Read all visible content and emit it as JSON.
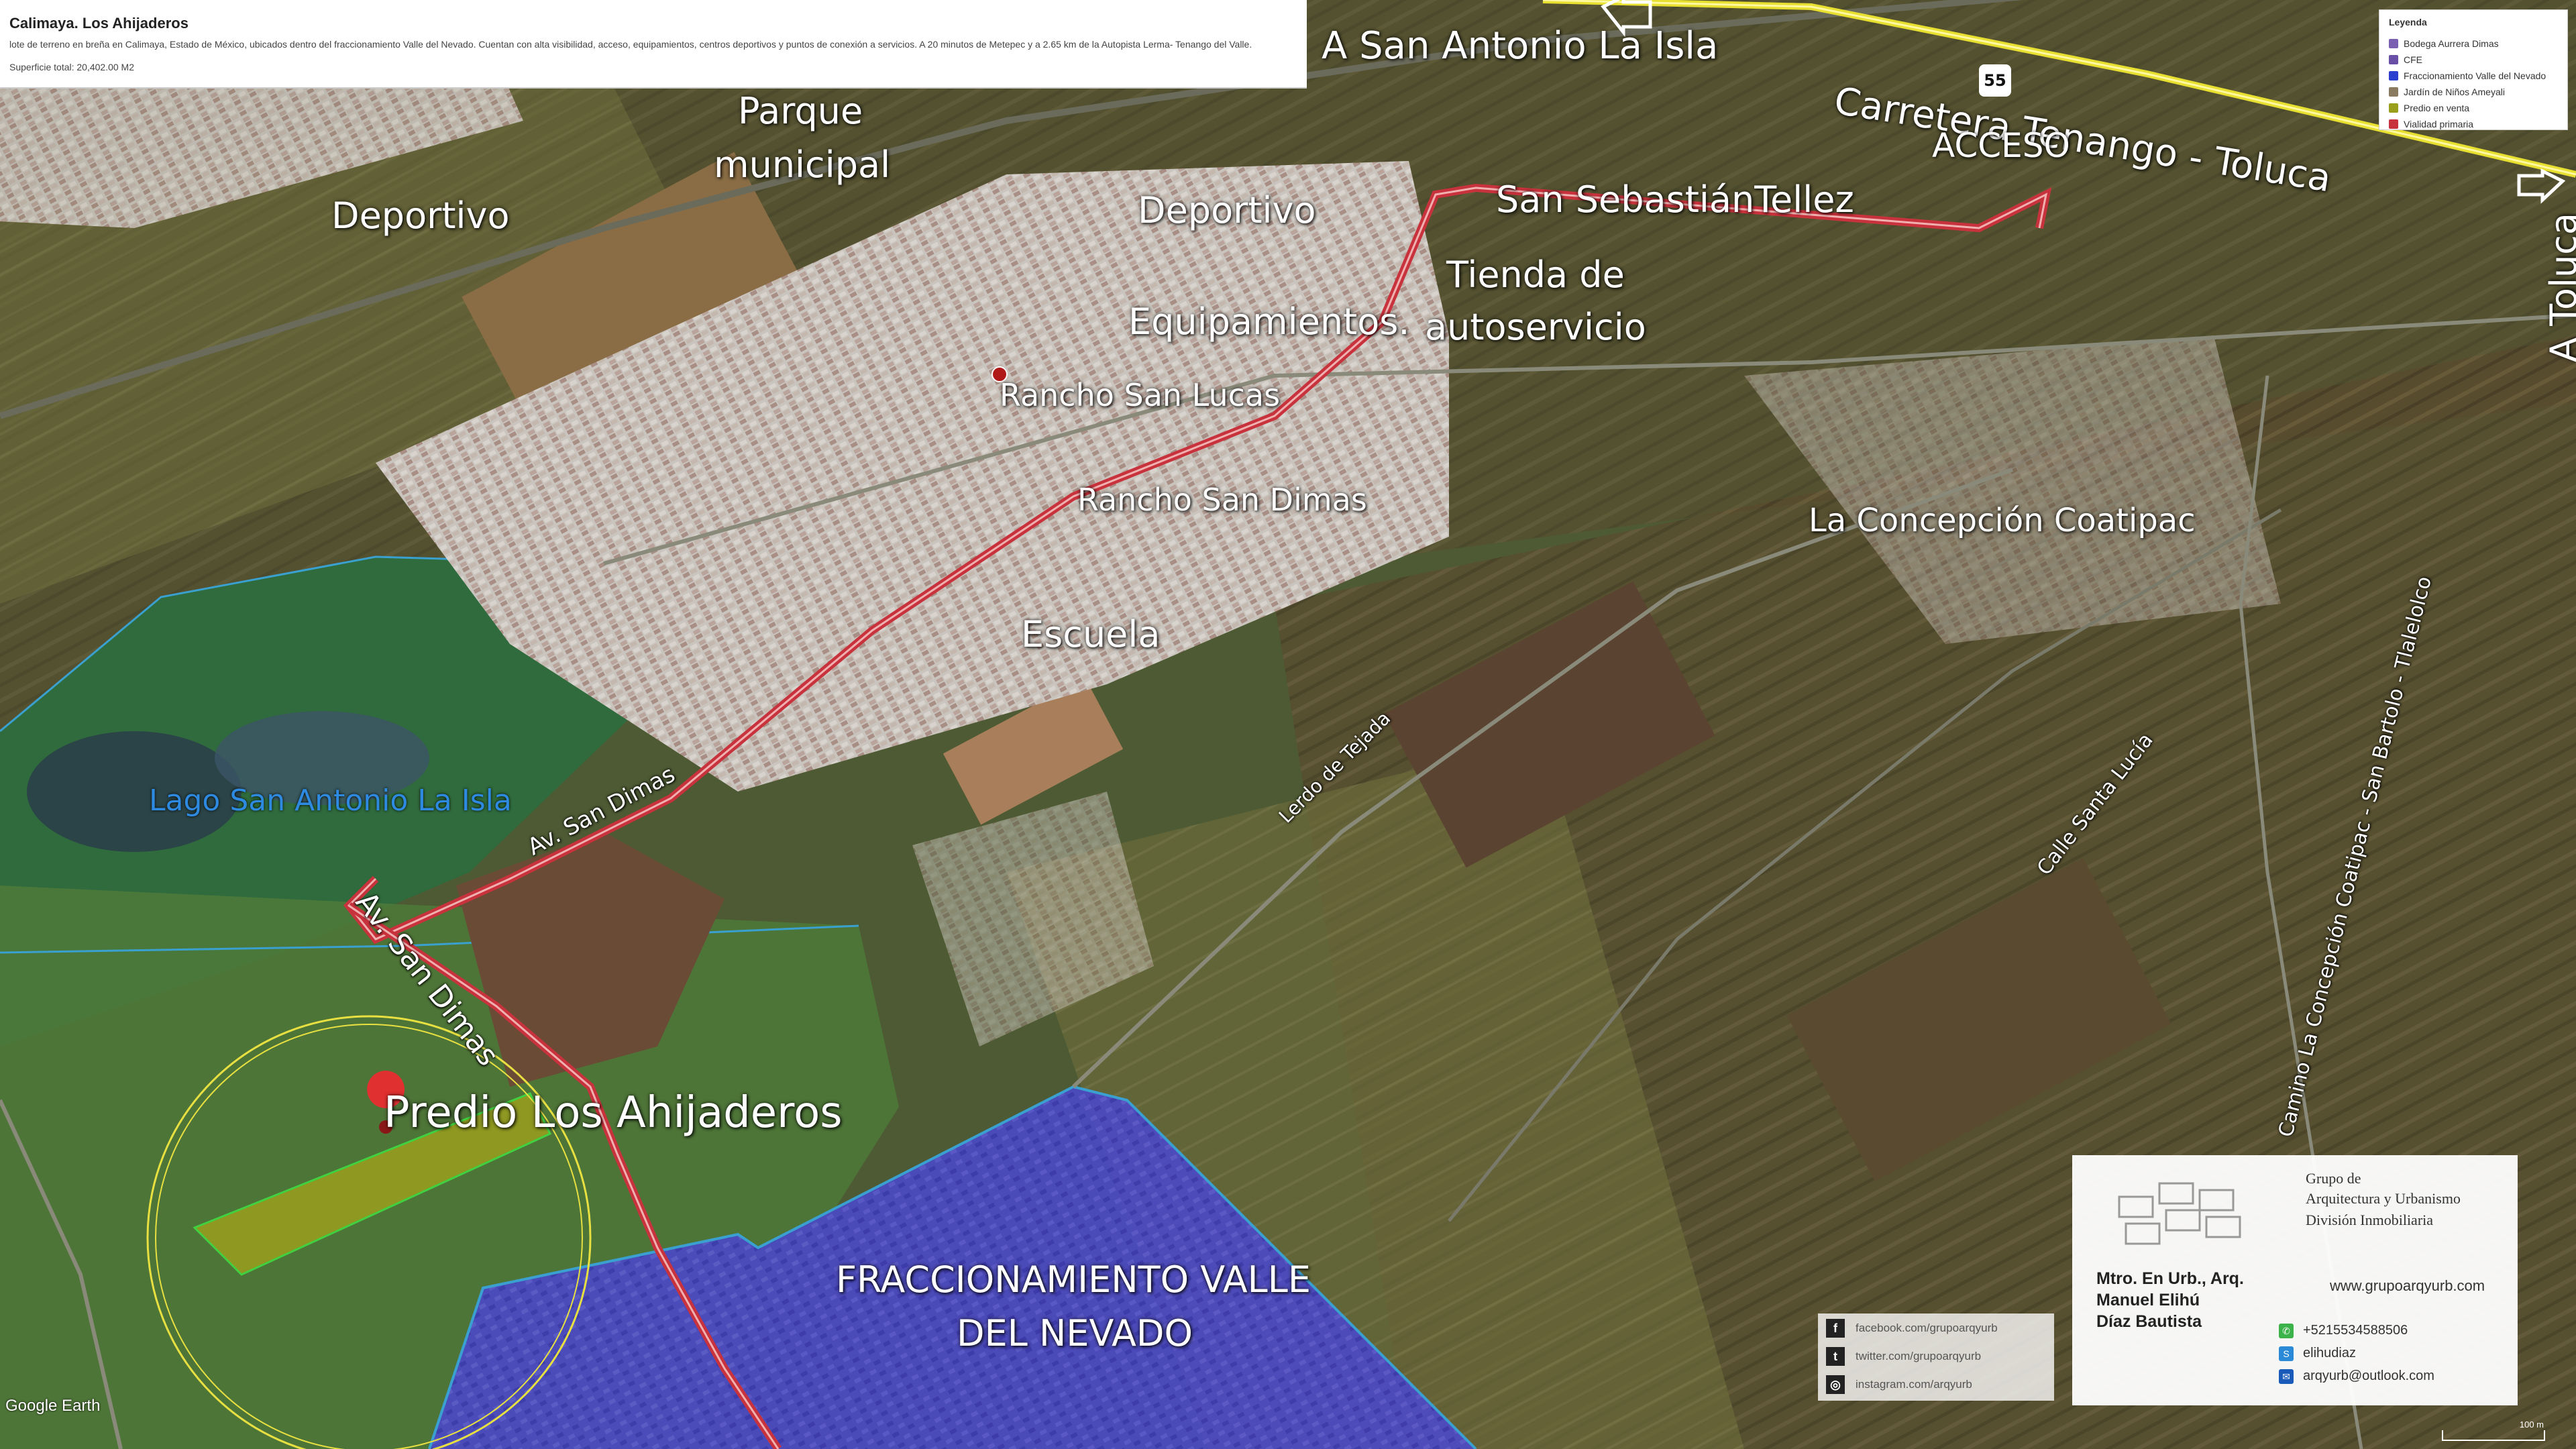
{
  "info": {
    "title": "Calimaya. Los Ahijaderos",
    "description": "lote de terreno en breña en Calimaya, Estado de México, ubicados dentro del fraccionamiento Valle del Nevado. Cuentan con alta visibilidad, acceso, equipamientos, centros deportivos y puntos de conexión a servicios. A 20 minutos de Metepec y a 2.65 km de la Autopista Lerma- Tenango del Valle.",
    "surface": "Superficie total: 20,402.00 M2"
  },
  "legend": {
    "heading": "Leyenda",
    "items": [
      {
        "label": "Bodega Aurrera Dimas",
        "color": "#7b5fb0"
      },
      {
        "label": "CFE",
        "color": "#6a4fa8"
      },
      {
        "label": "Fraccionamiento Valle del Nevado",
        "color": "#2a3fd0"
      },
      {
        "label": "Jardín de Niños Ameyali",
        "color": "#8a7a60"
      },
      {
        "label": "Predio en venta",
        "color": "#9aa01c"
      },
      {
        "label": "Vialidad primaria",
        "color": "#c8323c"
      }
    ]
  },
  "labels": {
    "a_san_antonio": "A San Antonio La Isla",
    "carretera": "Carretera Tenango - Toluca",
    "acceso": "ACCESO",
    "a_toluca": "A Toluca",
    "parque": "Parque",
    "municipal": "municipal",
    "deportivo_1": "Deportivo",
    "deportivo_2": "Deportivo",
    "san_sebastian": "San SebastiánTellez",
    "tienda": "Tienda de",
    "autoservicio": "autoservicio",
    "equipamientos": "Equipamientos.",
    "rancho_san_lucas": "Rancho San Lucas",
    "rancho_san_dimas": "Rancho San Dimas",
    "la_concepcion": "La Concepción Coatipac",
    "escuela": "Escuela",
    "lago": "Lago San Antonio La Isla",
    "predio": "Predio Los Ahijaderos",
    "fracc_1": "FRACCIONAMIENTO VALLE",
    "fracc_2": "DEL NEVADO",
    "av_san_dimas_1": "Av. San Dimas",
    "av_san_dimas_2": "Av. San Dimas",
    "lerdo": "Lerdo de Tejada",
    "calle_santa_lucia": "Calle Santa Lucía",
    "camino": "Camino La Concepción Coatipac - San Bartolo - Tlalelolco",
    "highway_shield": "55"
  },
  "card": {
    "org_line1": "Grupo de",
    "org_line2": "Arquitectura y Urbanismo",
    "org_line3": "División Inmobiliaria",
    "name_line1": "Mtro. En Urb., Arq.",
    "name_line2": "Manuel Elihú",
    "name_line3": "Díaz Bautista",
    "website": "www.grupoarqyurb.com",
    "phone": "+5215534588506",
    "skype": "elihudiaz",
    "email": "arqyurb@outlook.com"
  },
  "social": {
    "facebook": "facebook.com/grupoarqyurb",
    "twitter": "twitter.com/grupoarqyurb",
    "instagram": "instagram.com/arqyurb"
  },
  "footer": {
    "brand": "Google Earth",
    "scale": "100 m"
  },
  "colors": {
    "fracc_fill": "#3f3fd0",
    "predio_fill": "#9a9a10",
    "road_red": "#c8323c",
    "highway_yellow": "#e8e030",
    "lake_outline": "#3aa0d0",
    "circle": "#e8e040"
  }
}
